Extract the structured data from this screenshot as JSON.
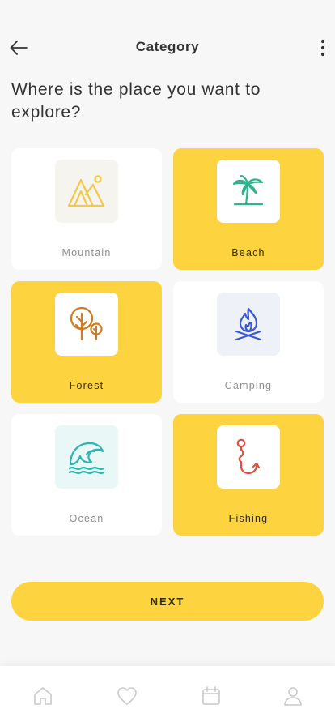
{
  "header": {
    "title": "Category",
    "back_icon": "arrow-left-icon",
    "more_icon": "more-vertical-icon"
  },
  "question": "Where is the place you want to explore?",
  "categories": [
    {
      "label": "Mountain",
      "selected": false,
      "icon": "mountain-icon"
    },
    {
      "label": "Beach",
      "selected": true,
      "icon": "palm-tree-icon"
    },
    {
      "label": "Forest",
      "selected": true,
      "icon": "tree-icon"
    },
    {
      "label": "Camping",
      "selected": false,
      "icon": "campfire-icon"
    },
    {
      "label": "Ocean",
      "selected": false,
      "icon": "wave-icon"
    },
    {
      "label": "Fishing",
      "selected": true,
      "icon": "fishing-hook-icon"
    }
  ],
  "next_label": "NEXT",
  "nav": {
    "items": [
      "home-icon",
      "heart-icon",
      "calendar-icon",
      "user-icon"
    ]
  },
  "colors": {
    "accent": "#fdd33f",
    "background": "#f7f7f7",
    "card": "#ffffff",
    "mountain_icon": "#f2c84b",
    "beach_icon": "#2eb48c",
    "forest_icon": "#d07a22",
    "camping_icon": "#3a57d9",
    "ocean_icon": "#2bb5b0",
    "fishing_icon": "#e84b3c"
  }
}
